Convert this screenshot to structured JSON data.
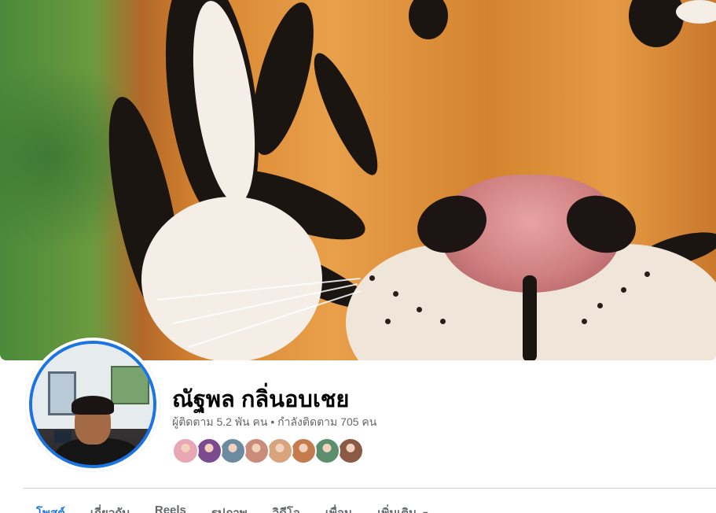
{
  "profile": {
    "name": "ณัฐพล กลิ่นอบเชย",
    "followers_label": "ผู้ติดตาม",
    "followers_count": "5.2 พัน",
    "followers_unit": "คน",
    "separator": " • ",
    "following_label": "กำลังติดตาม",
    "following_count": "705",
    "following_unit": "คน"
  },
  "friend_avatar_colors": [
    "#e9a6b5",
    "#7b4a8f",
    "#6c8aa0",
    "#c98b7a",
    "#d9a37e",
    "#c47c4f",
    "#5b8e6a",
    "#8a5a45"
  ],
  "tabs": [
    {
      "label": "โพสต์",
      "active": true
    },
    {
      "label": "เกี่ยวกับ",
      "active": false
    },
    {
      "label": "Reels",
      "active": false
    },
    {
      "label": "รูปภาพ",
      "active": false
    },
    {
      "label": "วิดีโอ",
      "active": false
    },
    {
      "label": "เพื่อน",
      "active": false
    },
    {
      "label": "เพิ่มเติม",
      "active": false,
      "has_caret": true
    }
  ],
  "colors": {
    "accent": "#1b74e4",
    "text_primary": "#050505",
    "text_secondary": "#65676b"
  }
}
